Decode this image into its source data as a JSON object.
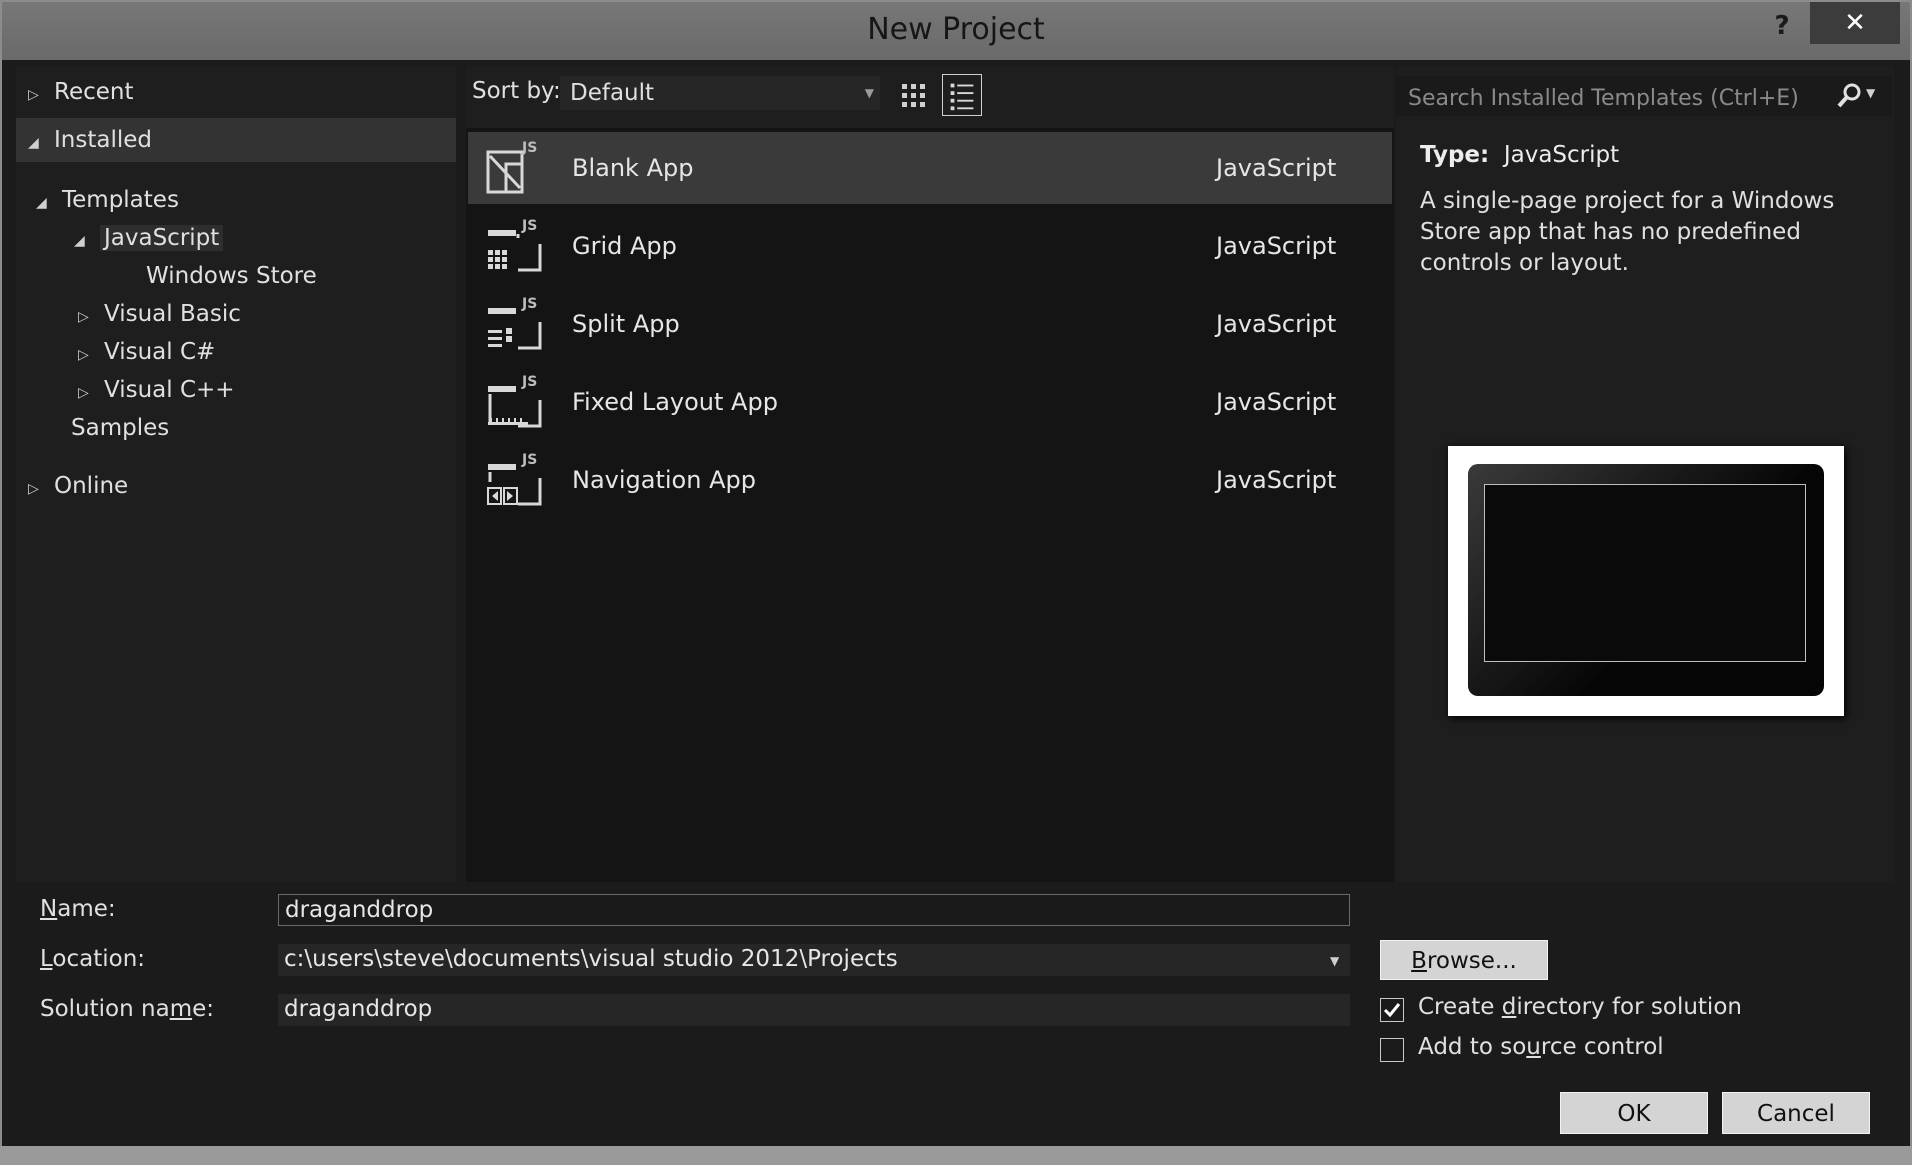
{
  "window": {
    "title": "New Project",
    "help_glyph": "?",
    "close_glyph": "✕"
  },
  "tree": {
    "recent": "Recent",
    "installed": "Installed",
    "templates": "Templates",
    "javascript": "JavaScript",
    "windows_store": "Windows Store",
    "visual_basic": "Visual Basic",
    "visual_csharp": "Visual C#",
    "visual_cpp": "Visual C++",
    "samples": "Samples",
    "online": "Online"
  },
  "toolbar": {
    "sort_label": "Sort by:",
    "sort_value": "Default"
  },
  "templates": [
    {
      "name": "Blank App",
      "lang": "JavaScript",
      "icon": "blank-app-icon",
      "selected": true
    },
    {
      "name": "Grid App",
      "lang": "JavaScript",
      "icon": "grid-app-icon"
    },
    {
      "name": "Split App",
      "lang": "JavaScript",
      "icon": "split-app-icon"
    },
    {
      "name": "Fixed Layout App",
      "lang": "JavaScript",
      "icon": "fixed-layout-app-icon"
    },
    {
      "name": "Navigation App",
      "lang": "JavaScript",
      "icon": "navigation-app-icon"
    }
  ],
  "details": {
    "search_placeholder": "Search Installed Templates (Ctrl+E)",
    "type_label": "Type:",
    "type_value": "JavaScript",
    "description": "A single-page project for a Windows Store app that has no predefined controls or layout."
  },
  "form": {
    "name_label": "Name:",
    "name_value": "draganddrop",
    "location_label": "Location:",
    "location_value": "c:\\users\\steve\\documents\\visual studio 2012\\Projects",
    "solution_label": "Solution name:",
    "solution_value": "draganddrop",
    "browse": "Browse...",
    "create_dir": "Create directory for solution",
    "create_dir_checked": true,
    "source_control": "Add to source control",
    "source_control_checked": false,
    "ok": "OK",
    "cancel": "Cancel"
  }
}
